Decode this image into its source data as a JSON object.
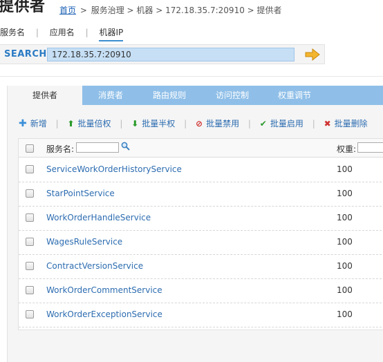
{
  "page": {
    "title": "提供者"
  },
  "breadcrumb": {
    "home": "首页",
    "rest": "服务治理 > 机器 > 172.18.35.7:20910 > 提供者"
  },
  "search_tabs": [
    {
      "label": "服务名",
      "active": false
    },
    {
      "label": "应用名",
      "active": false
    },
    {
      "label": "机器IP",
      "active": true
    }
  ],
  "search": {
    "label": "SEARCH",
    "value": "172.18.35.7:20910",
    "go_icon": "arrow-right-icon"
  },
  "tabs": [
    {
      "label": "提供者",
      "active": true
    },
    {
      "label": "消费者",
      "active": false
    },
    {
      "label": "路由规则",
      "active": false
    },
    {
      "label": "访问控制",
      "active": false
    },
    {
      "label": "权重调节",
      "active": false
    }
  ],
  "toolbar": [
    {
      "icon": "plus-icon",
      "glyph": "✚",
      "label": "新增"
    },
    {
      "icon": "arrow-up-icon",
      "glyph": "⬆",
      "label": "批量倍权"
    },
    {
      "icon": "arrow-down-icon",
      "glyph": "⬇",
      "label": "批量半权"
    },
    {
      "icon": "ban-icon",
      "glyph": "⊘",
      "label": "批量禁用"
    },
    {
      "icon": "check-icon",
      "glyph": "✔",
      "label": "批量启用"
    },
    {
      "icon": "x-icon",
      "glyph": "✖",
      "label": "批量删除"
    }
  ],
  "table": {
    "header": {
      "service_label": "服务名:",
      "weight_label": "权重:"
    },
    "rows": [
      {
        "service": "ServiceWorkOrderHistoryService",
        "weight": "100"
      },
      {
        "service": "StarPointService",
        "weight": "100"
      },
      {
        "service": "WorkOrderHandleService",
        "weight": "100"
      },
      {
        "service": "WagesRuleService",
        "weight": "100"
      },
      {
        "service": "ContractVersionService",
        "weight": "100"
      },
      {
        "service": "WorkOrderCommentService",
        "weight": "100"
      },
      {
        "service": "WorkOrderExceptionService",
        "weight": "100"
      }
    ]
  },
  "colors": {
    "accent": "#2a7bc4",
    "tab_bar": "#8fbfe8",
    "link": "#2c6cb0",
    "search_value_bg": "#c6dff5"
  }
}
